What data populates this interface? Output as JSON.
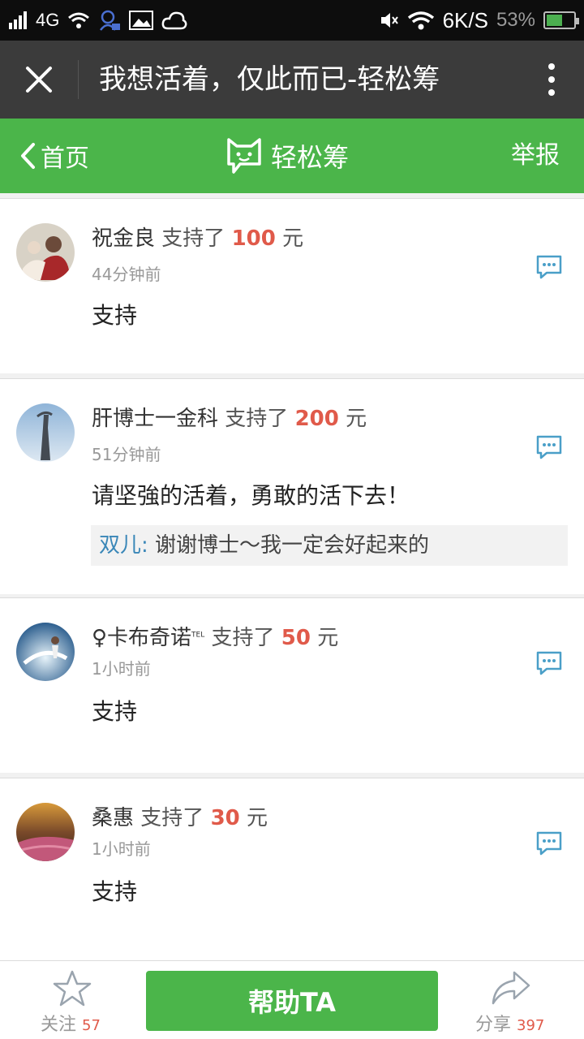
{
  "status_bar": {
    "network": "4G",
    "speed": "6K/S",
    "battery": "53%",
    "battery_level": 0.53
  },
  "title_bar": {
    "title": "我想活着，仅此而已-轻松筹"
  },
  "nav": {
    "back_label": "首页",
    "brand": "轻松筹",
    "report": "举报",
    "color": "#4bb54a"
  },
  "comments": [
    {
      "name": "祝金良",
      "verb": "支持了",
      "amount": "100",
      "unit": "元",
      "time": "44分钟前",
      "message": "支持"
    },
    {
      "name": "肝博士一金科",
      "verb": "支持了",
      "amount": "200",
      "unit": "元",
      "time": "51分钟前",
      "message": "请坚強的活着，勇敢的活下去！",
      "reply_name": "双儿:",
      "reply_text": " 谢谢博士～我一定会好起来的"
    },
    {
      "name": "♀卡布奇诺",
      "name_sup": "TEL",
      "verb": "支持了",
      "amount": "50",
      "unit": "元",
      "time": "1小时前",
      "message": "支持"
    },
    {
      "name": "桑惠",
      "verb": "支持了",
      "amount": "30",
      "unit": "元",
      "time": "1小时前",
      "message": "支持"
    }
  ],
  "bottom_bar": {
    "follow_label": "关注",
    "follow_count": "57",
    "help_label": "帮助TA",
    "share_label": "分享",
    "share_count": "397"
  },
  "icons": [
    "close-icon",
    "more-icon",
    "back-chevron-icon",
    "cat-logo-icon",
    "comment-icon",
    "star-icon",
    "share-arrow-icon"
  ]
}
